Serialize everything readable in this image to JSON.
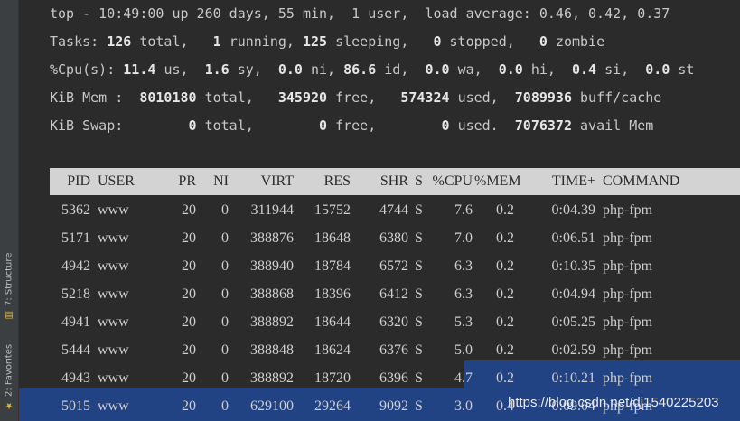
{
  "sidebar": {
    "structure_tab": "7: Structure",
    "favorites_tab": "2: Favorites"
  },
  "summary": {
    "top_line": "top - 10:49:00 up 260 days, 55 min,  1 user,  load average: 0.46, 0.42, 0.37",
    "tasks": {
      "label": "Tasks:",
      "total": "126",
      "total_lbl": "total,",
      "running": "1",
      "running_lbl": "running,",
      "sleeping": "125",
      "sleeping_lbl": "sleeping,",
      "stopped": "0",
      "stopped_lbl": "stopped,",
      "zombie": "0",
      "zombie_lbl": "zombie"
    },
    "cpu": {
      "label": "%Cpu(s):",
      "us": "11.4",
      "us_lbl": "us,",
      "sy": "1.6",
      "sy_lbl": "sy,",
      "ni": "0.0",
      "ni_lbl": "ni,",
      "id": "86.6",
      "id_lbl": "id,",
      "wa": "0.0",
      "wa_lbl": "wa,",
      "hi": "0.0",
      "hi_lbl": "hi,",
      "si": "0.4",
      "si_lbl": "si,",
      "st": "0.0",
      "st_lbl": "st"
    },
    "mem": {
      "label": "KiB Mem :",
      "total": "8010180",
      "total_lbl": "total,",
      "free": "345920",
      "free_lbl": "free,",
      "used": "574324",
      "used_lbl": "used,",
      "buff": "7089936",
      "buff_lbl": "buff/cache"
    },
    "swap": {
      "label": "KiB Swap:",
      "total": "0",
      "total_lbl": "total,",
      "free": "0",
      "free_lbl": "free,",
      "used": "0",
      "used_lbl": "used.",
      "avail": "7076372",
      "avail_lbl": "avail Mem"
    }
  },
  "table": {
    "headers": [
      "PID",
      "USER",
      "PR",
      "NI",
      "VIRT",
      "RES",
      "SHR",
      "S",
      "%CPU",
      "%MEM",
      "TIME+",
      "COMMAND"
    ],
    "rows": [
      [
        "5362",
        "www",
        "20",
        "0",
        "311944",
        "15752",
        "4744",
        "S",
        "7.6",
        "0.2",
        "0:04.39",
        "php-fpm"
      ],
      [
        "5171",
        "www",
        "20",
        "0",
        "388876",
        "18648",
        "6380",
        "S",
        "7.0",
        "0.2",
        "0:06.51",
        "php-fpm"
      ],
      [
        "4942",
        "www",
        "20",
        "0",
        "388940",
        "18784",
        "6572",
        "S",
        "6.3",
        "0.2",
        "0:10.35",
        "php-fpm"
      ],
      [
        "5218",
        "www",
        "20",
        "0",
        "388868",
        "18396",
        "6412",
        "S",
        "6.3",
        "0.2",
        "0:04.94",
        "php-fpm"
      ],
      [
        "4941",
        "www",
        "20",
        "0",
        "388892",
        "18644",
        "6320",
        "S",
        "5.3",
        "0.2",
        "0:05.25",
        "php-fpm"
      ],
      [
        "5444",
        "www",
        "20",
        "0",
        "388848",
        "18624",
        "6376",
        "S",
        "5.0",
        "0.2",
        "0:02.59",
        "php-fpm"
      ],
      [
        "4943",
        "www",
        "20",
        "0",
        "388892",
        "18720",
        "6396",
        "S",
        "4.7",
        "0.2",
        "0:10.21",
        "php-fpm"
      ],
      [
        "5015",
        "www",
        "20",
        "0",
        "629100",
        "29264",
        "9092",
        "S",
        "3.0",
        "0.4",
        "0:09.04",
        "php-fpm"
      ]
    ]
  },
  "watermark": "https://blog.csdn.net/dj1540225203",
  "colors": {
    "background": "#2b2b2b",
    "selection": "#214283",
    "header_bg": "#d3d3d3"
  }
}
